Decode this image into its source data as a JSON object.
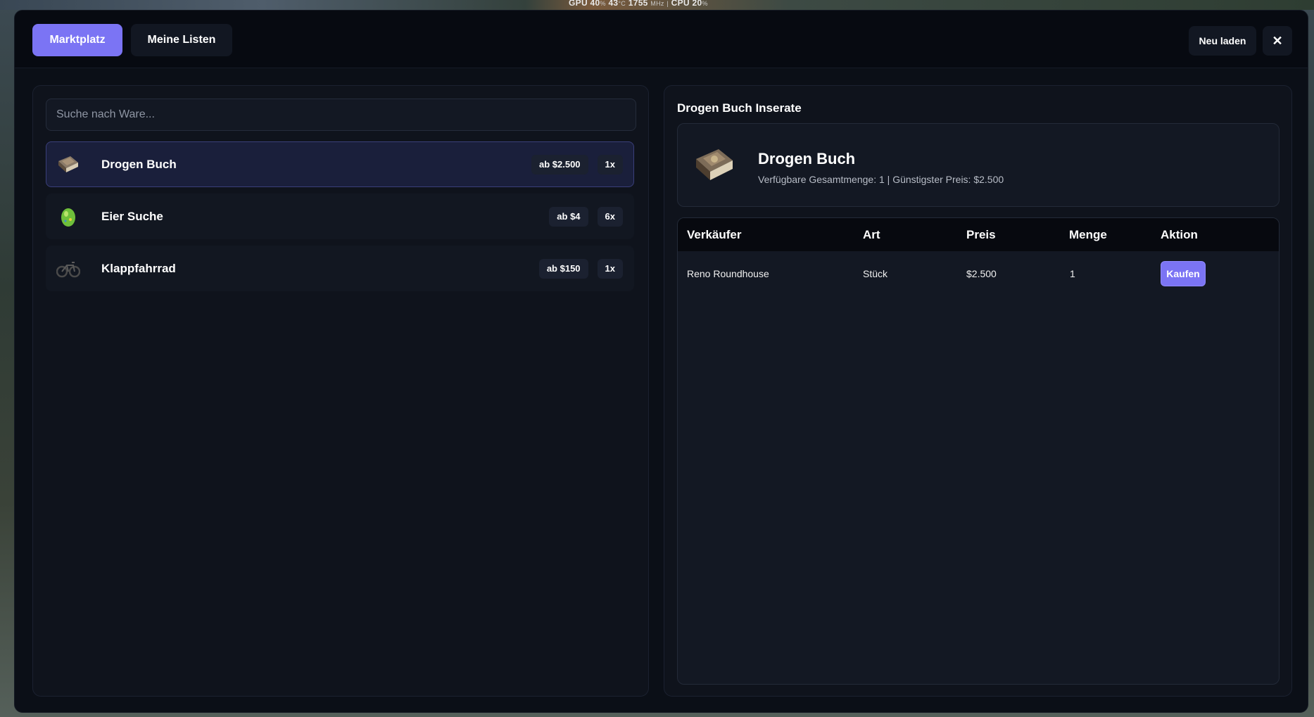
{
  "hud": {
    "gpu_label": "GPU",
    "gpu_value": "40",
    "gpu_unit": "%",
    "temp_value": "43",
    "temp_unit": "°C",
    "clock_value": "1755",
    "clock_unit": "MHz",
    "separator": "|",
    "cpu_label": "CPU",
    "cpu_value": "20",
    "cpu_unit": "%"
  },
  "topbar": {
    "tabs": [
      {
        "label": "Marktplatz",
        "active": true
      },
      {
        "label": "Meine Listen",
        "active": false
      }
    ],
    "reload_label": "Neu laden",
    "close_label": "✕"
  },
  "search": {
    "placeholder": "Suche nach Ware..."
  },
  "items": [
    {
      "name": "Drogen Buch",
      "price": "ab $2.500",
      "qty": "1x",
      "icon": "book-icon",
      "active": true
    },
    {
      "name": "Eier Suche",
      "price": "ab $4",
      "qty": "6x",
      "icon": "egg-icon",
      "active": false
    },
    {
      "name": "Klappfahrrad",
      "price": "ab $150",
      "qty": "1x",
      "icon": "bicycle-icon",
      "active": false
    }
  ],
  "detail": {
    "section_title": "Drogen Buch Inserate",
    "title": "Drogen Buch",
    "subtitle": "Verfügbare Gesamtmenge: 1 | Günstigster Preis: $2.500",
    "icon": "book-icon"
  },
  "table": {
    "headers": [
      "Verkäufer",
      "Art",
      "Preis",
      "Menge",
      "Aktion"
    ],
    "rows": [
      {
        "seller": "Reno Roundhouse",
        "type": "Stück",
        "price": "$2.500",
        "qty": "1",
        "action": "Kaufen"
      }
    ]
  },
  "colors": {
    "accent": "#7b74f4",
    "background": "#0b0f17",
    "panel": "#0f131c"
  }
}
